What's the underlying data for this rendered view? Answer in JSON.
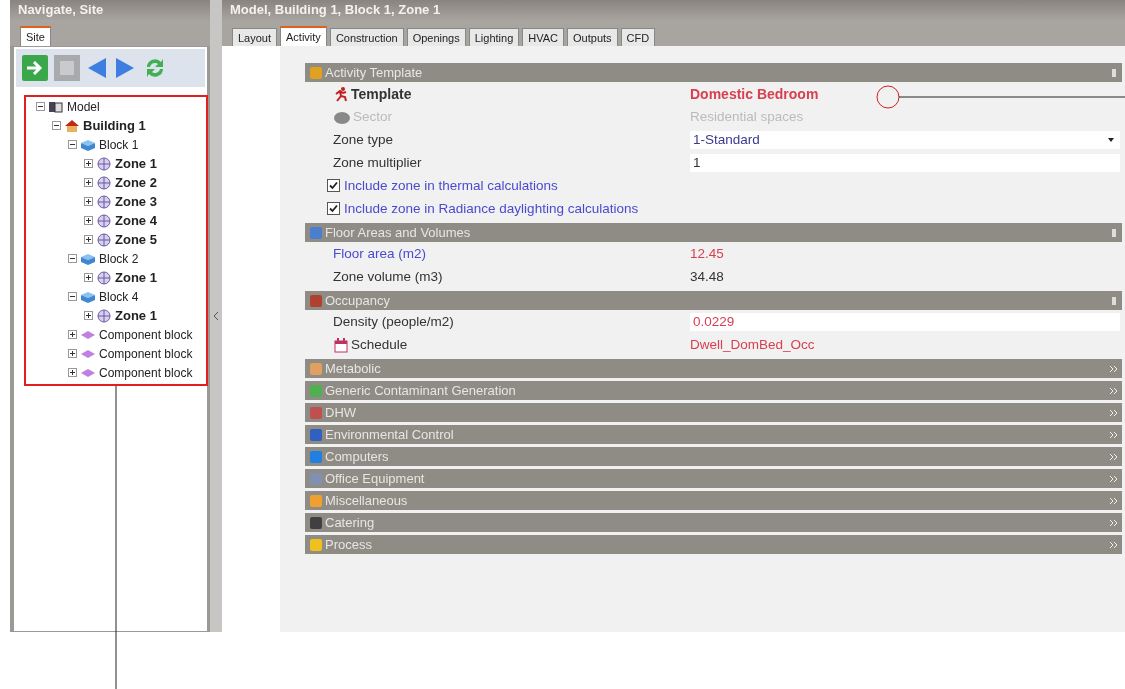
{
  "navigator": {
    "title": "Navigate, Site",
    "tabs": [
      {
        "label": "Site",
        "selected": true
      }
    ],
    "tree": [
      {
        "label": "Model",
        "kind": "model",
        "expanded": true,
        "children": [
          {
            "label": "Building 1",
            "kind": "building",
            "expanded": true,
            "children": [
              {
                "label": "Block 1",
                "kind": "block",
                "expanded": true,
                "children": [
                  {
                    "label": "Zone 1",
                    "kind": "zone",
                    "expanded": false
                  },
                  {
                    "label": "Zone 2",
                    "kind": "zone",
                    "expanded": false
                  },
                  {
                    "label": "Zone 3",
                    "kind": "zone",
                    "expanded": false
                  },
                  {
                    "label": "Zone 4",
                    "kind": "zone",
                    "expanded": false
                  },
                  {
                    "label": "Zone 5",
                    "kind": "zone",
                    "expanded": false
                  }
                ]
              },
              {
                "label": "Block 2",
                "kind": "block",
                "expanded": true,
                "children": [
                  {
                    "label": "Zone 1",
                    "kind": "zone",
                    "expanded": false
                  }
                ]
              },
              {
                "label": "Block 4",
                "kind": "block",
                "expanded": true,
                "children": [
                  {
                    "label": "Zone 1",
                    "kind": "zone",
                    "expanded": false
                  }
                ]
              },
              {
                "label": "Component block",
                "kind": "component",
                "expanded": false
              },
              {
                "label": "Component block",
                "kind": "component",
                "expanded": false
              },
              {
                "label": "Component block",
                "kind": "component",
                "expanded": false
              }
            ]
          }
        ]
      }
    ]
  },
  "editor": {
    "title": "Model, Building 1, Block 1, Zone 1",
    "tabs": [
      {
        "label": "Layout",
        "selected": false
      },
      {
        "label": "Activity",
        "selected": true
      },
      {
        "label": "Construction",
        "selected": false
      },
      {
        "label": "Openings",
        "selected": false
      },
      {
        "label": "Lighting",
        "selected": false
      },
      {
        "label": "HVAC",
        "selected": false
      },
      {
        "label": "Outputs",
        "selected": false
      },
      {
        "label": "CFD",
        "selected": false
      }
    ],
    "sections": [
      {
        "title": "Activity Template",
        "expanded": true,
        "rows": [
          {
            "kind": "title",
            "label": "Template",
            "value": "Domestic Bedroom",
            "inherited": true
          },
          {
            "kind": "icon-text",
            "label": "Sector",
            "value": "Residential spaces",
            "disabled": true
          },
          {
            "kind": "select",
            "label": "Zone type",
            "value": "1-Standard"
          },
          {
            "kind": "input",
            "label": "Zone multiplier",
            "value": "1"
          },
          {
            "kind": "checkbox",
            "label": "Include zone in thermal calculations",
            "checked": true
          },
          {
            "kind": "checkbox",
            "label": "Include zone in Radiance daylighting calculations",
            "checked": true
          }
        ]
      },
      {
        "title": "Floor Areas and Volumes",
        "expanded": true,
        "rows": [
          {
            "kind": "text",
            "label": "Floor area (m2)",
            "value": "12.45",
            "inherited": true,
            "linked": true
          },
          {
            "kind": "text",
            "label": "Zone volume (m3)",
            "value": "34.48"
          }
        ]
      },
      {
        "title": "Occupancy",
        "expanded": true,
        "rows": [
          {
            "kind": "input",
            "label": "Density (people/m2)",
            "value": "0.0229",
            "inherited": true
          },
          {
            "kind": "icon-text",
            "label": "Schedule",
            "value": "Dwell_DomBed_Occ",
            "inherited": true
          }
        ]
      },
      {
        "title": "Metabolic",
        "expanded": false
      },
      {
        "title": "Generic Contaminant Generation",
        "expanded": false
      },
      {
        "title": "DHW",
        "expanded": false
      },
      {
        "title": "Environmental Control",
        "expanded": false
      },
      {
        "title": "Computers",
        "expanded": false
      },
      {
        "title": "Office Equipment",
        "expanded": false
      },
      {
        "title": "Miscellaneous",
        "expanded": false
      },
      {
        "title": "Catering",
        "expanded": false
      },
      {
        "title": "Process",
        "expanded": false
      }
    ]
  }
}
